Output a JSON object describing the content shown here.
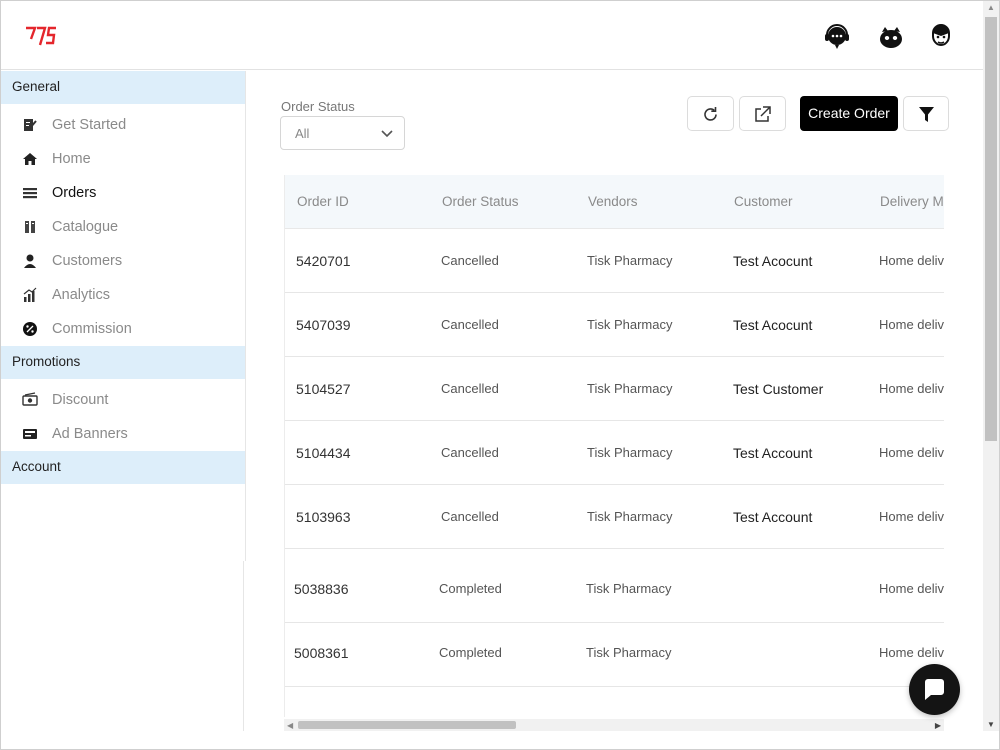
{
  "colors": {
    "brand": "#e4262c",
    "accent": "#000000",
    "section_bg": "#ddeefa",
    "header_bg": "#f4f8fb"
  },
  "topbar": {
    "icons": [
      "support-chat-icon",
      "robot-icon",
      "user-avatar-icon"
    ]
  },
  "sidebar": {
    "sections": [
      {
        "title": "General",
        "items": [
          {
            "label": "Get Started",
            "icon": "edit-doc-icon"
          },
          {
            "label": "Home",
            "icon": "home-icon"
          },
          {
            "label": "Orders",
            "icon": "orders-list-icon"
          },
          {
            "label": "Catalogue",
            "icon": "catalogue-icon"
          },
          {
            "label": "Customers",
            "icon": "customer-icon"
          },
          {
            "label": "Analytics",
            "icon": "analytics-icon"
          },
          {
            "label": "Commission",
            "icon": "percent-icon"
          }
        ]
      },
      {
        "title": "Promotions",
        "items": [
          {
            "label": "Discount",
            "icon": "discount-tag-icon"
          },
          {
            "label": "Ad Banners",
            "icon": "banner-icon"
          }
        ]
      },
      {
        "title": "Account",
        "items": []
      }
    ]
  },
  "filters": {
    "order_status_label": "Order Status",
    "order_status_value": "All"
  },
  "toolbar": {
    "create_order_label": "Create Order"
  },
  "table": {
    "columns": [
      "Order ID",
      "Order Status",
      "Vendors",
      "Customer",
      "Delivery M"
    ],
    "rows": [
      {
        "id": "5420701",
        "status": "Cancelled",
        "vendor": "Tisk Pharmacy",
        "customer": "Test Acocunt",
        "delivery": "Home deliv"
      },
      {
        "id": "5407039",
        "status": "Cancelled",
        "vendor": "Tisk Pharmacy",
        "customer": "Test Acocunt",
        "delivery": "Home deliv"
      },
      {
        "id": "5104527",
        "status": "Cancelled",
        "vendor": "Tisk Pharmacy",
        "customer": "Test Customer",
        "delivery": "Home deliv"
      },
      {
        "id": "5104434",
        "status": "Cancelled",
        "vendor": "Tisk Pharmacy",
        "customer": "Test Account",
        "delivery": "Home deliv"
      },
      {
        "id": "5103963",
        "status": "Cancelled",
        "vendor": "Tisk Pharmacy",
        "customer": "Test Account",
        "delivery": "Home deliv"
      },
      {
        "id": "5038836",
        "status": "Completed",
        "vendor": "Tisk Pharmacy",
        "customer": "",
        "delivery": "Home deliv"
      },
      {
        "id": "5008361",
        "status": "Completed",
        "vendor": "Tisk Pharmacy",
        "customer": "",
        "delivery": "Home deliv"
      }
    ]
  }
}
